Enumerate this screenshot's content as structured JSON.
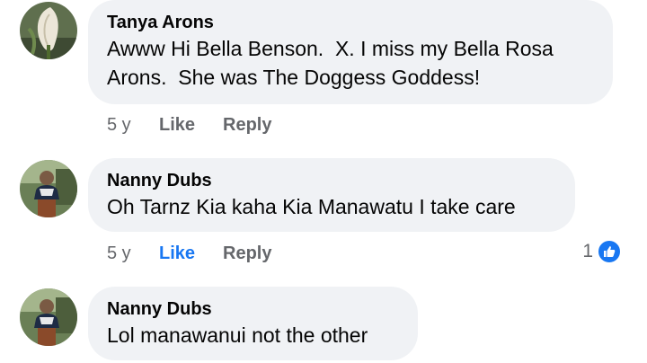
{
  "comments": [
    {
      "author": "Tanya Arons",
      "text": "Awww Hi Bella Benson.  X. I miss my Bella Rosa Arons.  She was The Doggess Goddess!",
      "time": "5 y",
      "like_label": "Like",
      "reply_label": "Reply",
      "avatar_icon": "calla-lily-avatar-icon"
    },
    {
      "author": "Nanny Dubs",
      "text": "Oh Tarnz Kia kaha Kia Manawatu I take care",
      "time": "5 y",
      "like_label": "Like",
      "reply_label": "Reply",
      "liked": true,
      "reaction_count": "1",
      "reaction_icon": "thumbs-up-icon",
      "avatar_icon": "person-avatar-icon"
    },
    {
      "author": "Nanny Dubs",
      "text": "Lol manawanui not the other",
      "avatar_icon": "person-avatar-icon"
    }
  ],
  "colors": {
    "bubble": "#f0f2f5",
    "link_blue": "#1877f2",
    "meta_gray": "#65676b"
  }
}
